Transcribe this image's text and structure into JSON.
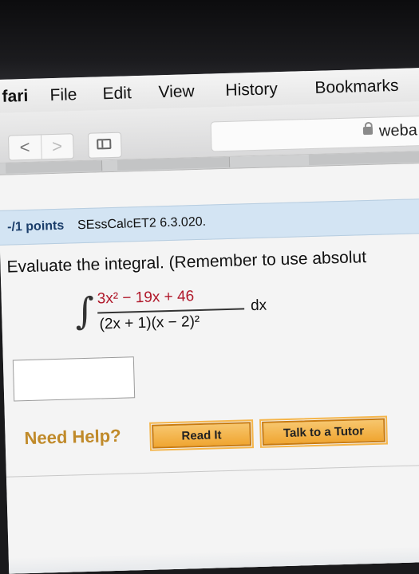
{
  "menubar": {
    "app_name": "fari",
    "items": [
      "File",
      "Edit",
      "View",
      "History",
      "Bookmarks"
    ]
  },
  "toolbar": {
    "back_glyph": "<",
    "forward_glyph": ">",
    "url_text": "weba"
  },
  "question": {
    "points": "-/1 points",
    "code": "SEssCalcET2 6.3.020.",
    "prompt": "Evaluate the integral. (Remember to use absolut",
    "integral_symbol": "∫",
    "numerator": "3x² − 19x + 46",
    "denominator": "(2x + 1)(x − 2)²",
    "differential": "dx"
  },
  "help": {
    "label": "Need Help?",
    "read_it": "Read It",
    "talk_to_tutor": "Talk to a Tutor"
  },
  "colors": {
    "header_bg": "#d3e4f3",
    "points_color": "#1a3d6a",
    "numerator_color": "#b0182a",
    "need_help_color": "#c08a2a",
    "button_bg": "#f0a632"
  }
}
